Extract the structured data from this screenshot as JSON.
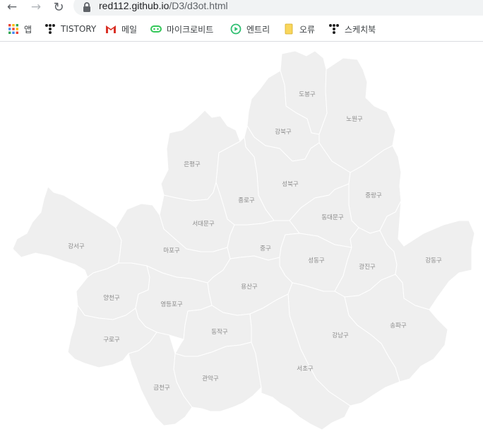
{
  "browser": {
    "url_host": "red112.github.io",
    "url_path": "/D3/d3ot.html"
  },
  "bookmarks": [
    {
      "label": "앱",
      "icon": "apps-grid-icon"
    },
    {
      "label": "TISTORY",
      "icon": "tistory-icon"
    },
    {
      "label": "메일",
      "icon": "gmail-icon"
    },
    {
      "label": "마이크로비트",
      "icon": "microbit-icon"
    },
    {
      "label": "엔트리",
      "icon": "entry-play-icon"
    },
    {
      "label": "오류",
      "icon": "folder-icon"
    },
    {
      "label": "스케치북",
      "icon": "tistory-icon"
    }
  ],
  "map": {
    "fill_color": "#efefef",
    "border_color": "#ffffff",
    "label_color": "#8a8a8a",
    "districts": [
      {
        "name": "도봉구"
      },
      {
        "name": "노원구"
      },
      {
        "name": "강북구"
      },
      {
        "name": "은평구"
      },
      {
        "name": "성북구"
      },
      {
        "name": "종로구"
      },
      {
        "name": "중랑구"
      },
      {
        "name": "서대문구"
      },
      {
        "name": "동대문구"
      },
      {
        "name": "강서구"
      },
      {
        "name": "마포구"
      },
      {
        "name": "중구"
      },
      {
        "name": "성동구"
      },
      {
        "name": "광진구"
      },
      {
        "name": "강동구"
      },
      {
        "name": "용산구"
      },
      {
        "name": "양천구"
      },
      {
        "name": "영등포구"
      },
      {
        "name": "송파구"
      },
      {
        "name": "강남구"
      },
      {
        "name": "동작구"
      },
      {
        "name": "구로구"
      },
      {
        "name": "관악구"
      },
      {
        "name": "서초구"
      },
      {
        "name": "금천구"
      }
    ]
  }
}
